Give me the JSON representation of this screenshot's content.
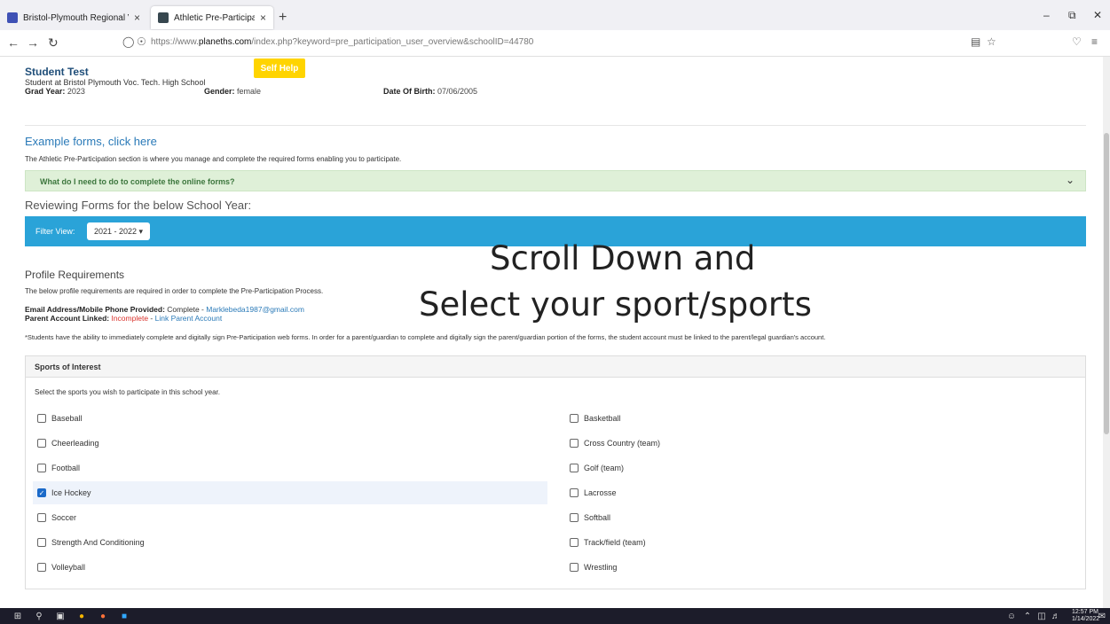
{
  "browser": {
    "tabs": [
      {
        "title": "Bristol-Plymouth Regional Voca",
        "favicon_color": "#3f51b5"
      },
      {
        "title": "Athletic Pre-Participation",
        "favicon_color": "#37474f"
      }
    ],
    "new_tab": "+",
    "close": "×",
    "url_prefix": "https://www.",
    "url_domain": "planeths.com",
    "url_rest": "/index.php?keyword=pre_participation_user_overview&schoolID=44780"
  },
  "student": {
    "name": "Student Test",
    "self_help": "Self Help",
    "school_line": "Student at Bristol Plymouth Voc. Tech. High School",
    "grad_label": "Grad Year:",
    "grad_value": "2023",
    "gender_label": "Gender:",
    "gender_value": "female",
    "dob_label": "Date Of Birth:",
    "dob_value": "07/06/2005"
  },
  "forms": {
    "example_link": "Example forms, click here",
    "intro": "The Athletic Pre-Participation section is where you manage and complete the required forms enabling you to participate.",
    "faq": "What do I need to do to complete the online forms?",
    "reviewing": "Reviewing Forms for the below School Year:",
    "filter_label": "Filter View:",
    "filter_value": "2021 - 2022 ▾"
  },
  "overlay": {
    "line1": "Scroll Down and",
    "line2": "Select your sport/sports"
  },
  "profile": {
    "title": "Profile Requirements",
    "desc": "The below profile requirements are required in order to complete the Pre-Participation Process.",
    "email_label": "Email Address/Mobile Phone Provided:",
    "email_status": "Complete",
    "email_value": "Marklebeda1987@gmail.com",
    "parent_label": "Parent Account Linked:",
    "parent_status": "Incomplete",
    "parent_link": "Link Parent Account",
    "separator": " - ",
    "note": "*Students have the ability to immediately complete and digitally sign Pre-Participation web forms. In order for a parent/guardian to complete and digitally sign the parent/guardian portion of the forms, the student account must be linked to the parent/legal guardian's account."
  },
  "sports": {
    "title": "Sports of Interest",
    "desc": "Select the sports you wish to participate in this school year.",
    "left": [
      {
        "label": "Baseball",
        "checked": false
      },
      {
        "label": "Cheerleading",
        "checked": false
      },
      {
        "label": "Football",
        "checked": false
      },
      {
        "label": "Ice Hockey",
        "checked": true
      },
      {
        "label": "Soccer",
        "checked": false
      },
      {
        "label": "Strength And Conditioning",
        "checked": false
      },
      {
        "label": "Volleyball",
        "checked": false
      }
    ],
    "right": [
      {
        "label": "Basketball",
        "checked": false
      },
      {
        "label": "Cross Country (team)",
        "checked": false
      },
      {
        "label": "Golf (team)",
        "checked": false
      },
      {
        "label": "Lacrosse",
        "checked": false
      },
      {
        "label": "Softball",
        "checked": false
      },
      {
        "label": "Track/field (team)",
        "checked": false
      },
      {
        "label": "Wrestling",
        "checked": false
      }
    ]
  },
  "taskbar": {
    "time": "12:57 PM",
    "date": "1/14/2022"
  },
  "colors": {
    "accent": "#2aa3d8",
    "link": "#2a7ab8",
    "danger": "#d9322c",
    "faq_bg": "#dff0d8",
    "self_help": "#ffd400"
  }
}
